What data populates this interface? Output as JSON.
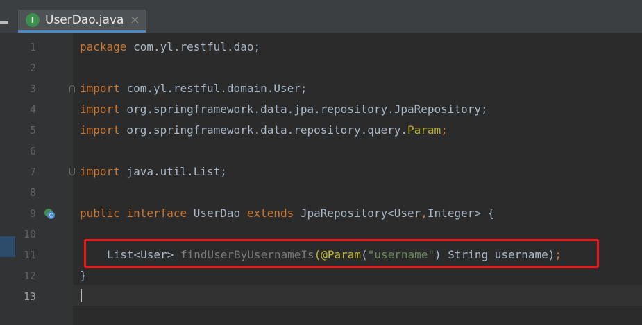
{
  "tab": {
    "icon_letter": "I",
    "title": "UserDao.java",
    "close": "×"
  },
  "lines": [
    {
      "num": "1"
    },
    {
      "num": "2"
    },
    {
      "num": "3"
    },
    {
      "num": "4"
    },
    {
      "num": "5"
    },
    {
      "num": "6"
    },
    {
      "num": "7"
    },
    {
      "num": "8"
    },
    {
      "num": "9"
    },
    {
      "num": "10"
    },
    {
      "num": "11"
    },
    {
      "num": "12"
    },
    {
      "num": "13"
    }
  ],
  "code": {
    "l1_kw": "package",
    "l1_rest": " com.yl.restful.dao;",
    "l3_kw": "import",
    "l3_rest": " com.yl.restful.domain.User;",
    "l4_kw": "import",
    "l4_rest": " org.springframework.data.jpa.repository.JpaRepository;",
    "l5_kw": "import",
    "l5_rest": " org.springframework.data.repository.query.",
    "l5_param": "Param",
    "l5_semi": ";",
    "l7_kw": "import",
    "l7_rest": " java.util.List;",
    "l9_public": "public",
    "l9_interface": " interface",
    "l9_name": " UserDao",
    "l9_extends": " extends",
    "l9_generic": " JpaRepository<User",
    "l9_comma": ",",
    "l9_integer": "Integer> {",
    "l11_type": "List<User> ",
    "l11_method": "findUserByUsernameIs",
    "l11_paren": "(",
    "l11_annotation": "@Param",
    "l11_paren2": "(",
    "l11_string": "\"username\"",
    "l11_args": ") String username)",
    "l11_semi": ";",
    "l12_brace": "}"
  },
  "colors": {
    "background": "#2b2b2b",
    "keyword": "#cc7832",
    "annotation": "#bbb529",
    "string": "#6a8759",
    "highlight": "#f0161a"
  }
}
